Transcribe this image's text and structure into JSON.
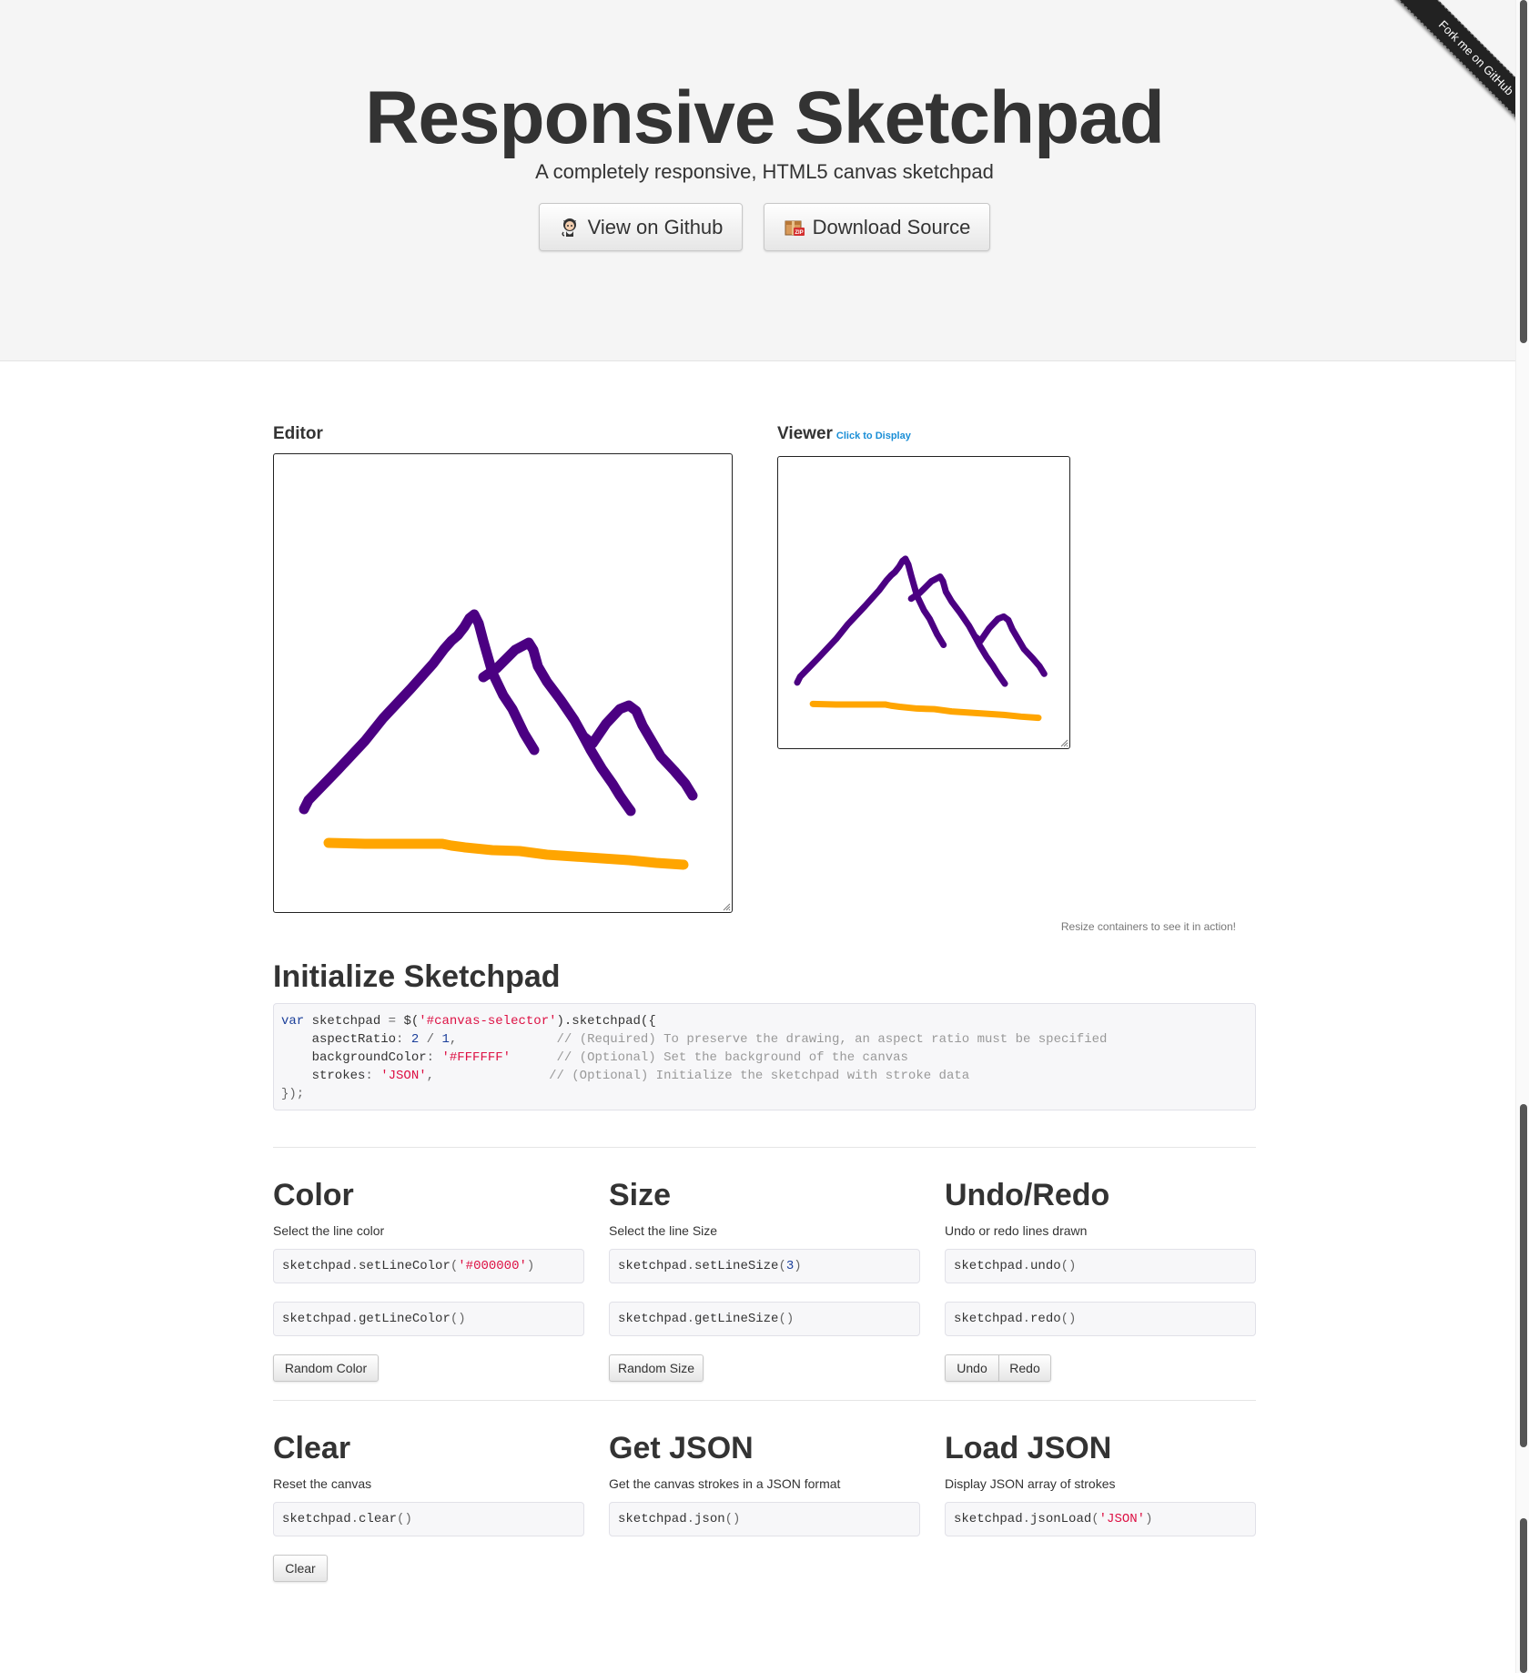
{
  "hero": {
    "title": "Responsive Sketchpad",
    "subtitle": "A completely responsive, HTML5 canvas sketchpad",
    "github_button": "View on Github",
    "download_button": "Download Source",
    "ribbon": "Fork me on GitHub"
  },
  "editor": {
    "label": "Editor"
  },
  "viewer": {
    "label": "Viewer",
    "click_link": "Click to Display"
  },
  "resize_note": "Resize containers to see it in action!",
  "stroke_colors": {
    "primary": "#4B0082",
    "secondary": "#FFA500"
  },
  "init": {
    "heading": "Initialize Sketchpad",
    "code": {
      "line1": {
        "kw": "var",
        "a": " sketchpad ",
        "p1": "=",
        "b": " $(",
        "s": "'#canvas-selector'",
        "c": ").sketchpad({"
      },
      "line2": {
        "prop": "    aspectRatio",
        "p": ":",
        "n1": " 2",
        "op": " /",
        "n2": " 1",
        "pc": ",",
        "cm": "             // (Required) To preserve the drawing, an aspect ratio must be specified"
      },
      "line3": {
        "prop": "    backgroundColor",
        "p": ":",
        "s": " '#FFFFFF'",
        "cm": "      // (Optional) Set the background of the canvas"
      },
      "line4": {
        "prop": "    strokes",
        "p": ":",
        "s": " 'JSON'",
        "pc": ",",
        "cm": "               // (Optional) Initialize the sketchpad with stroke data"
      },
      "line5": "});"
    }
  },
  "sections": {
    "color": {
      "heading": "Color",
      "desc": "Select the line color",
      "code1_a": "sketchpad",
      "code1_b": ".",
      "code1_c": "setLineColor",
      "code1_d": "(",
      "code1_s": "'#000000'",
      "code1_e": ")",
      "code2_a": "sketchpad",
      "code2_b": ".",
      "code2_c": "getLineColor",
      "code2_d": "()",
      "button": "Random Color"
    },
    "size": {
      "heading": "Size",
      "desc": "Select the line Size",
      "code1_a": "sketchpad",
      "code1_b": ".",
      "code1_c": "setLineSize",
      "code1_d": "(",
      "code1_n": "3",
      "code1_e": ")",
      "code2_a": "sketchpad",
      "code2_b": ".",
      "code2_c": "getLineSize",
      "code2_d": "()",
      "button": "Random Size"
    },
    "undo": {
      "heading": "Undo/Redo",
      "desc": "Undo or redo lines drawn",
      "code1_a": "sketchpad",
      "code1_b": ".",
      "code1_c": "undo",
      "code1_d": "()",
      "code2_a": "sketchpad",
      "code2_b": ".",
      "code2_c": "redo",
      "code2_d": "()",
      "undo_button": "Undo",
      "redo_button": "Redo"
    },
    "clear": {
      "heading": "Clear",
      "desc": "Reset the canvas",
      "code1_a": "sketchpad",
      "code1_b": ".",
      "code1_c": "clear",
      "code1_d": "()",
      "button": "Clear"
    },
    "json": {
      "heading": "Get JSON",
      "desc": "Get the canvas strokes in a JSON format",
      "code1_a": "sketchpad",
      "code1_b": ".",
      "code1_c": "json",
      "code1_d": "()"
    },
    "load": {
      "heading": "Load JSON",
      "desc": "Display JSON array of strokes",
      "code1_a": "sketchpad",
      "code1_b": ".",
      "code1_c": "jsonLoad",
      "code1_d": "(",
      "code1_s": "'JSON'",
      "code1_e": ")"
    }
  }
}
